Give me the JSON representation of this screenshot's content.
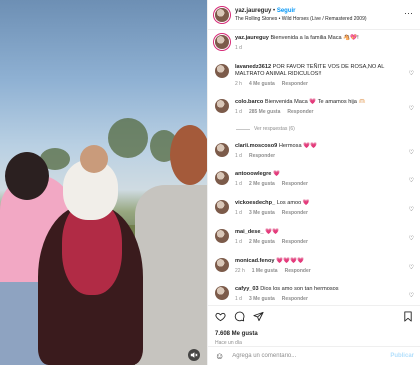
{
  "post": {
    "username": "yaz.jaureguy",
    "separator": "•",
    "follow_label": "Seguir",
    "audio": "The Rolling Stones • Wild Horses (Live / Remastered 2009)"
  },
  "caption": {
    "username": "yaz.jaureguy",
    "text": "Bienvenida a la familia Maca 🐴💖!",
    "time": "1 d"
  },
  "comments": [
    {
      "user": "lavanedz3612",
      "text": "POR FAVOR TEÑITE VOS DE ROSA,NO AL MALTRATO ANIMAL RIDICULOS!!",
      "time": "2 h",
      "likes": "4 Me gusta",
      "reply": "Responder"
    },
    {
      "user": "colo.barco",
      "text": "Bienvenida Maca 💗 Te amamos hija 🫶🏻",
      "time": "1 d",
      "likes": "285 Me gusta",
      "reply": "Responder"
    },
    {
      "user": "clarii.moscoso9",
      "text": "Hermosa 💗💗",
      "time": "1 d",
      "likes": "",
      "reply": "Responder"
    },
    {
      "user": "antooowlegre",
      "text": "💗",
      "time": "1 d",
      "likes": "2 Me gusta",
      "reply": "Responder"
    },
    {
      "user": "vickoesdechp_",
      "text": "Los amoo 💗",
      "time": "1 d",
      "likes": "3 Me gusta",
      "reply": "Responder"
    },
    {
      "user": "mai_dese_",
      "text": "💗💗",
      "time": "1 d",
      "likes": "2 Me gusta",
      "reply": "Responder"
    },
    {
      "user": "monicad.fenoy",
      "text": "💗💗💗💗",
      "time": "22 h",
      "likes": "1 Me gusta",
      "reply": "Responder"
    },
    {
      "user": "cafyy_03",
      "text": "Dios los amo son tan hermosos",
      "time": "1 d",
      "likes": "3 Me gusta",
      "reply": "Responder"
    }
  ],
  "view_replies": "Ver respuestas (6)",
  "actions": {
    "likes": "7.608 Me gusta",
    "time_ago": "Hace un día"
  },
  "add_comment": {
    "placeholder": "Agrega un comentario...",
    "publish": "Publicar"
  },
  "colors": {
    "accent": "#0095f6",
    "publish_disabled": "#b2dffc",
    "muted_text": "#8e8e8e",
    "heart_pink": "#ff3e8a"
  },
  "icons": {
    "more": "more-options-icon",
    "like": "heart-icon",
    "comment": "comment-icon",
    "share": "send-icon",
    "save": "bookmark-icon",
    "emoji": "emoji-icon",
    "mute": "speaker-muted-icon"
  }
}
